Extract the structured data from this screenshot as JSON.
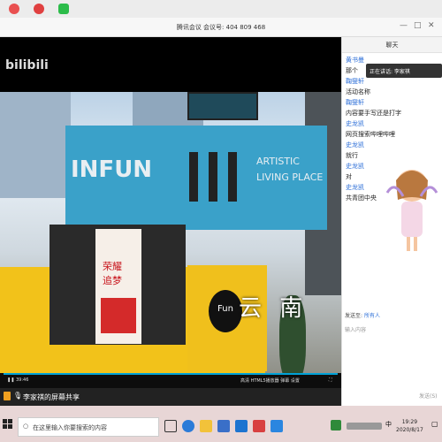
{
  "meeting": {
    "title": "腾讯会议  会议号:  404 809 468"
  },
  "video": {
    "watermark": "bilibili",
    "sign_left": "INFUN",
    "sign_right": "ARTISTIC\nLIVING PLACE",
    "poster_text": "荣耀之城 追梦青春",
    "store_text": "Fun",
    "overlay_text": "云 南",
    "time": "39:46",
    "controls_right": "高清  HTML5播放器  弹幕  设置"
  },
  "share": {
    "label": "李家祺的屏幕共享"
  },
  "chat": {
    "title": "聊天",
    "speaking": "正在讲话: 李家祺",
    "messages": [
      {
        "sender": "黄书曼",
        "text": "那个"
      },
      {
        "sender": "鞠燮轩",
        "text": "活动名称"
      },
      {
        "sender": "鞠燮轩",
        "text": "内容要手写还是打字"
      },
      {
        "sender": "史龙凯",
        "text": "网页搜索哔哩哔哩"
      },
      {
        "sender": "史龙凯",
        "text": "就行"
      },
      {
        "sender": "史龙凯",
        "text": "对"
      },
      {
        "sender": "史龙凯",
        "text": "共青团中央"
      }
    ],
    "send_to_label": "发送至:",
    "send_to_value": "所有人",
    "input_placeholder": "输入内容",
    "send_button": "发送(S)"
  },
  "taskbar": {
    "search_placeholder": "在这里输入你要搜索的内容",
    "time": "19:29",
    "date": "2020/8/17",
    "lang": "中"
  },
  "colors": {
    "container_blue": "#3aa1c9",
    "container_yellow": "#f2c21a",
    "chat_name": "#2d6fd8",
    "taskbar": "#e8d6d6"
  }
}
